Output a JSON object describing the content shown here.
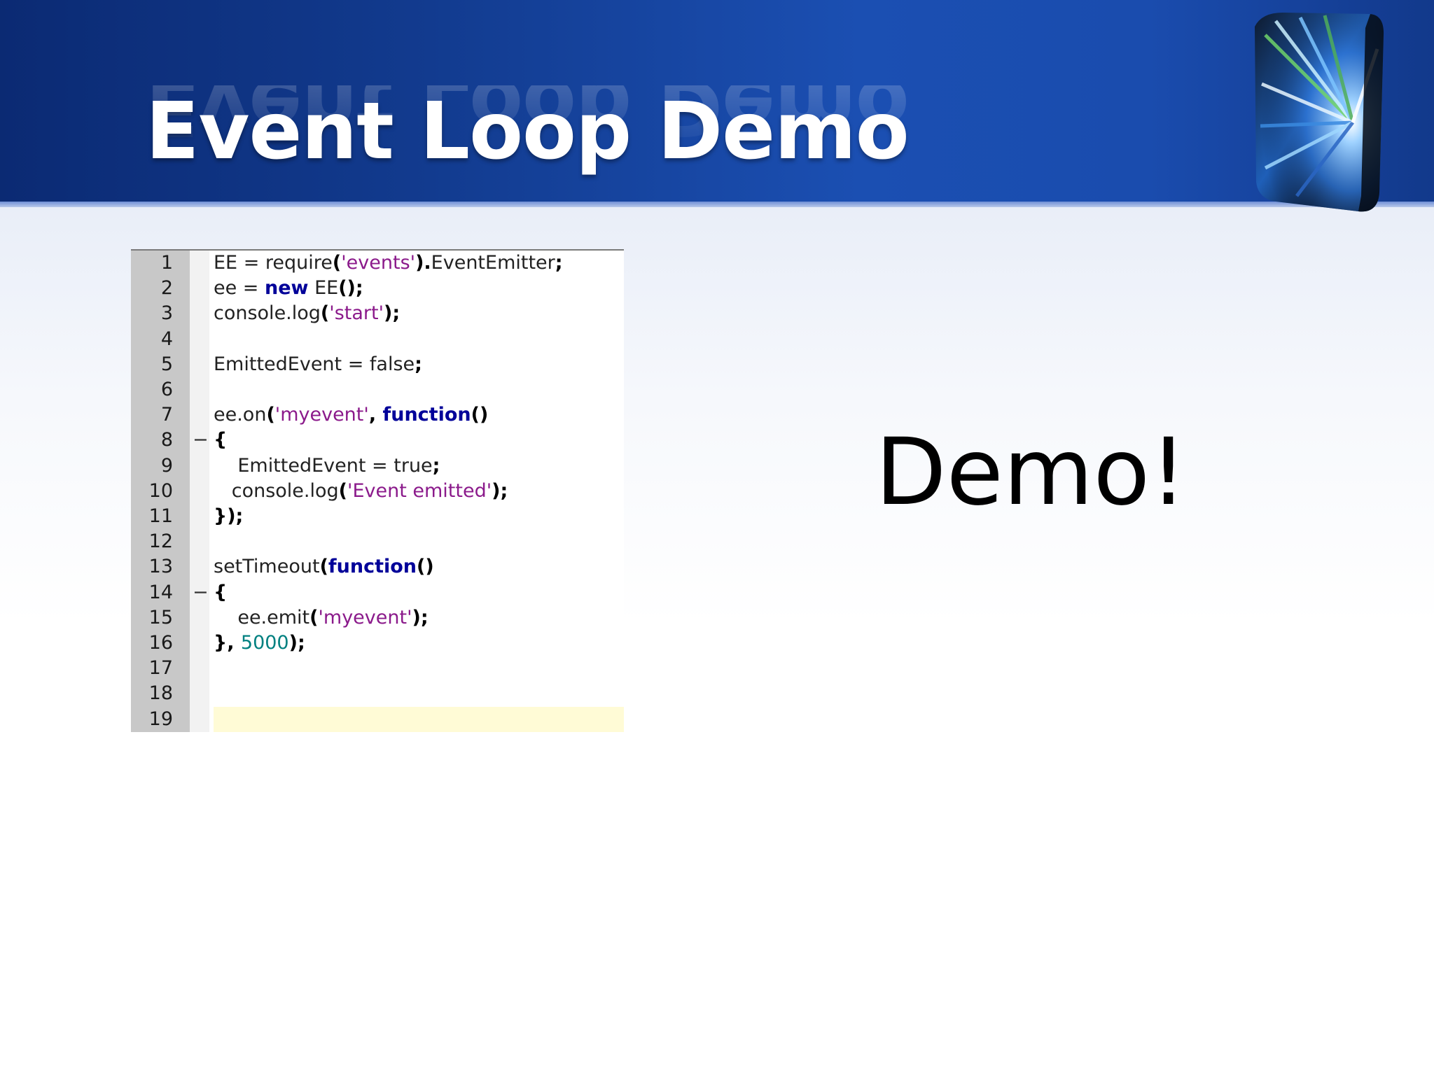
{
  "slide": {
    "title": "Event Loop Demo",
    "side_text": "Demo!"
  },
  "editor": {
    "lines": [
      {
        "n": "1",
        "fold": "",
        "code": [
          {
            "t": "EE = require",
            "c": "plain"
          },
          {
            "t": "(",
            "c": "op"
          },
          {
            "t": "'events'",
            "c": "str"
          },
          {
            "t": ").",
            "c": "op"
          },
          {
            "t": "EventEmitter",
            "c": "plain"
          },
          {
            "t": ";",
            "c": "op"
          }
        ]
      },
      {
        "n": "2",
        "fold": "",
        "code": [
          {
            "t": "ee = ",
            "c": "plain"
          },
          {
            "t": "new",
            "c": "kw"
          },
          {
            "t": " EE",
            "c": "plain"
          },
          {
            "t": "();",
            "c": "op"
          }
        ]
      },
      {
        "n": "3",
        "fold": "",
        "code": [
          {
            "t": "console.log",
            "c": "plain"
          },
          {
            "t": "(",
            "c": "op"
          },
          {
            "t": "'start'",
            "c": "str"
          },
          {
            "t": ");",
            "c": "op"
          }
        ]
      },
      {
        "n": "4",
        "fold": "",
        "code": []
      },
      {
        "n": "5",
        "fold": "",
        "code": [
          {
            "t": "EmittedEvent = false",
            "c": "plain"
          },
          {
            "t": ";",
            "c": "op"
          }
        ]
      },
      {
        "n": "6",
        "fold": "",
        "code": []
      },
      {
        "n": "7",
        "fold": "",
        "code": [
          {
            "t": "ee.on",
            "c": "plain"
          },
          {
            "t": "(",
            "c": "op"
          },
          {
            "t": "'myevent'",
            "c": "str"
          },
          {
            "t": ", ",
            "c": "op"
          },
          {
            "t": "function",
            "c": "kw"
          },
          {
            "t": "()",
            "c": "op"
          }
        ]
      },
      {
        "n": "8",
        "fold": "−",
        "code": [
          {
            "t": "{",
            "c": "op"
          }
        ]
      },
      {
        "n": "9",
        "fold": "",
        "code": [
          {
            "t": "    EmittedEvent = true",
            "c": "plain"
          },
          {
            "t": ";",
            "c": "op"
          }
        ]
      },
      {
        "n": "10",
        "fold": "",
        "code": [
          {
            "t": "   console.log",
            "c": "plain"
          },
          {
            "t": "(",
            "c": "op"
          },
          {
            "t": "'Event emitted'",
            "c": "str"
          },
          {
            "t": ");",
            "c": "op"
          }
        ]
      },
      {
        "n": "11",
        "fold": "",
        "code": [
          {
            "t": "});",
            "c": "op"
          }
        ]
      },
      {
        "n": "12",
        "fold": "",
        "code": []
      },
      {
        "n": "13",
        "fold": "",
        "code": [
          {
            "t": "setTimeout",
            "c": "plain"
          },
          {
            "t": "(",
            "c": "op"
          },
          {
            "t": "function",
            "c": "kw"
          },
          {
            "t": "()",
            "c": "op"
          }
        ]
      },
      {
        "n": "14",
        "fold": "−",
        "code": [
          {
            "t": "{",
            "c": "op"
          }
        ]
      },
      {
        "n": "15",
        "fold": "",
        "code": [
          {
            "t": "    ee.emit",
            "c": "plain"
          },
          {
            "t": "(",
            "c": "op"
          },
          {
            "t": "'myevent'",
            "c": "str"
          },
          {
            "t": ");",
            "c": "op"
          }
        ]
      },
      {
        "n": "16",
        "fold": "",
        "code": [
          {
            "t": "}, ",
            "c": "op"
          },
          {
            "t": "5000",
            "c": "num"
          },
          {
            "t": ");",
            "c": "op"
          }
        ]
      },
      {
        "n": "17",
        "fold": "",
        "code": []
      },
      {
        "n": "18",
        "fold": "",
        "code": []
      },
      {
        "n": "19",
        "fold": "",
        "code": [],
        "current": true
      }
    ]
  },
  "colors": {
    "header_dark": "#0b2a73",
    "header_light": "#1b4fb2",
    "string": "#8b1a8b",
    "keyword": "#000099",
    "number": "#008080",
    "gutter": "#c8c8c8",
    "current_line": "#fffbd6"
  },
  "icons": {
    "logo": "light-burst-cube-icon"
  }
}
